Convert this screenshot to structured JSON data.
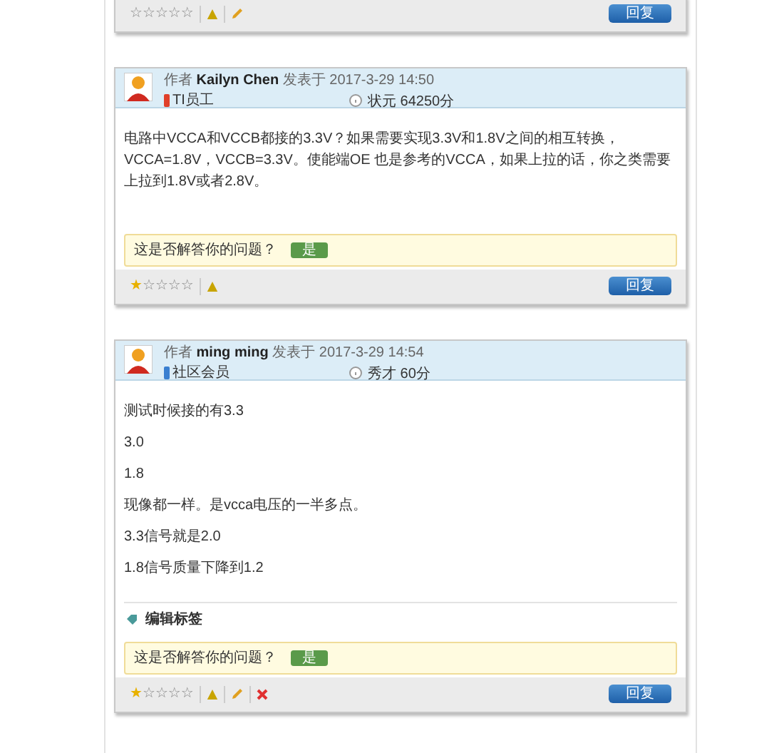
{
  "posts": [
    {
      "kind": "footer-only",
      "stars": 0,
      "actions": [
        {
          "kind": "report"
        },
        {
          "kind": "edit"
        }
      ],
      "reply": "回复"
    },
    {
      "kind": "full",
      "byline": "作者 **Kailyn Chen** 发表于 2017-3-29 14:50",
      "role": "TI员工",
      "color": "#e0402a",
      "rank": "状元 64250分",
      "paragraphs": [
        "电路中VCCA和VCCB都接的3.3V？如果需要实现3.3V和1.8V之间的相互转换，VCCA=1.8V，VCCB=3.3V。使能端OE 也是参考的VCCA，如果上拉的话，你之类需要上拉到1.8V或者2.8V。"
      ],
      "question": "这是否解答你的问题？",
      "yes": "是",
      "stars": 1,
      "actions": [
        {
          "kind": "report"
        }
      ],
      "reply": "回复"
    },
    {
      "kind": "full",
      "byline": "作者 **ming ming** 发表于 2017-3-29 14:54",
      "role": "社区会员",
      "color": "#3a7fd0",
      "rank": "秀才 60分",
      "paragraphs": [
        "测试时候接的有3.3",
        "3.0",
        "1.8",
        "现像都一样。是vcca电压的一半多点。",
        "3.3信号就是2.0",
        "1.8信号质量下降到1.2"
      ],
      "tags_label": "编辑标签",
      "question": "这是否解答你的问题？",
      "yes": "是",
      "stars": 1,
      "actions": [
        {
          "kind": "report"
        },
        {
          "kind": "edit"
        },
        {
          "kind": "delete"
        }
      ],
      "reply": "回复"
    }
  ]
}
